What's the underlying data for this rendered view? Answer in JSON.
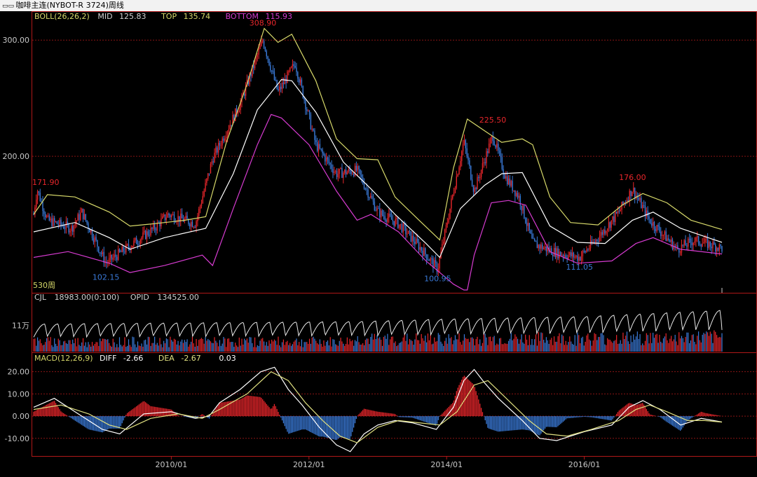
{
  "window": {
    "title": "咖啡主连(NYBOT-R 3724)周线",
    "icon": "chart-window-icon"
  },
  "colors": {
    "background": "#000000",
    "frame": "#b01818",
    "grid": "#8a1414",
    "up": "#e8262b",
    "down": "#3a7ad8",
    "mid": "#ffffff",
    "top": "#d7d96a",
    "bottom": "#d63bd0",
    "diff": "#ffffff",
    "dea": "#e0e080",
    "label": "#c8c8c8"
  },
  "chart_data": [
    {
      "panel": "price",
      "type": "candlestick",
      "indicator": {
        "name": "BOLL(26,26,2)",
        "mid_label": "MID",
        "mid": "125.83",
        "top_label": "TOP",
        "top": "135.74",
        "bottom_label": "BOTTOM",
        "bottom": "115.93"
      },
      "y_ticks": [
        "300.00",
        "200.00"
      ],
      "y_tick_values": [
        300,
        200
      ],
      "ylim": [
        85,
        320
      ],
      "bars_label": "530周",
      "annotations": [
        {
          "text": "171.90",
          "value": 171.9,
          "t": 0.0,
          "color": "up"
        },
        {
          "text": "102.15",
          "value": 102.15,
          "t": 0.105,
          "color": "down"
        },
        {
          "text": "308.90",
          "value": 308.9,
          "t": 0.333,
          "color": "up"
        },
        {
          "text": "100.95",
          "value": 100.95,
          "t": 0.587,
          "color": "down"
        },
        {
          "text": "225.50",
          "value": 225.5,
          "t": 0.667,
          "color": "up"
        },
        {
          "text": "111.05",
          "value": 111.05,
          "t": 0.793,
          "color": "down"
        },
        {
          "text": "176.00",
          "value": 176.0,
          "t": 0.87,
          "color": "up"
        }
      ],
      "trend": [
        {
          "t": 0.0,
          "v": 150
        },
        {
          "t": 0.005,
          "v": 171.9
        },
        {
          "t": 0.02,
          "v": 145
        },
        {
          "t": 0.055,
          "v": 138
        },
        {
          "t": 0.07,
          "v": 152
        },
        {
          "t": 0.105,
          "v": 108
        },
        {
          "t": 0.14,
          "v": 123
        },
        {
          "t": 0.175,
          "v": 138
        },
        {
          "t": 0.195,
          "v": 150
        },
        {
          "t": 0.235,
          "v": 142
        },
        {
          "t": 0.26,
          "v": 198
        },
        {
          "t": 0.3,
          "v": 245
        },
        {
          "t": 0.333,
          "v": 300
        },
        {
          "t": 0.355,
          "v": 255
        },
        {
          "t": 0.38,
          "v": 280
        },
        {
          "t": 0.41,
          "v": 210
        },
        {
          "t": 0.44,
          "v": 185
        },
        {
          "t": 0.47,
          "v": 188
        },
        {
          "t": 0.5,
          "v": 152
        },
        {
          "t": 0.53,
          "v": 142
        },
        {
          "t": 0.555,
          "v": 126
        },
        {
          "t": 0.587,
          "v": 103
        },
        {
          "t": 0.61,
          "v": 170
        },
        {
          "t": 0.625,
          "v": 213
        },
        {
          "t": 0.64,
          "v": 170
        },
        {
          "t": 0.667,
          "v": 218
        },
        {
          "t": 0.685,
          "v": 183
        },
        {
          "t": 0.705,
          "v": 165
        },
        {
          "t": 0.725,
          "v": 125
        },
        {
          "t": 0.76,
          "v": 117
        },
        {
          "t": 0.793,
          "v": 113
        },
        {
          "t": 0.82,
          "v": 130
        },
        {
          "t": 0.85,
          "v": 152
        },
        {
          "t": 0.87,
          "v": 172
        },
        {
          "t": 0.895,
          "v": 145
        },
        {
          "t": 0.935,
          "v": 120
        },
        {
          "t": 0.96,
          "v": 128
        },
        {
          "t": 1.0,
          "v": 121
        }
      ],
      "boll_top": [
        {
          "t": 0.0,
          "v": 150
        },
        {
          "t": 0.02,
          "v": 167
        },
        {
          "t": 0.06,
          "v": 165
        },
        {
          "t": 0.11,
          "v": 152
        },
        {
          "t": 0.14,
          "v": 140
        },
        {
          "t": 0.175,
          "v": 142
        },
        {
          "t": 0.22,
          "v": 145
        },
        {
          "t": 0.25,
          "v": 148
        },
        {
          "t": 0.28,
          "v": 212
        },
        {
          "t": 0.31,
          "v": 262
        },
        {
          "t": 0.335,
          "v": 310
        },
        {
          "t": 0.355,
          "v": 298
        },
        {
          "t": 0.375,
          "v": 305
        },
        {
          "t": 0.41,
          "v": 265
        },
        {
          "t": 0.44,
          "v": 215
        },
        {
          "t": 0.47,
          "v": 198
        },
        {
          "t": 0.5,
          "v": 197
        },
        {
          "t": 0.525,
          "v": 165
        },
        {
          "t": 0.56,
          "v": 145
        },
        {
          "t": 0.59,
          "v": 128
        },
        {
          "t": 0.61,
          "v": 190
        },
        {
          "t": 0.63,
          "v": 232
        },
        {
          "t": 0.655,
          "v": 222
        },
        {
          "t": 0.68,
          "v": 212
        },
        {
          "t": 0.71,
          "v": 215
        },
        {
          "t": 0.725,
          "v": 210
        },
        {
          "t": 0.75,
          "v": 165
        },
        {
          "t": 0.78,
          "v": 143
        },
        {
          "t": 0.82,
          "v": 141
        },
        {
          "t": 0.855,
          "v": 158
        },
        {
          "t": 0.885,
          "v": 168
        },
        {
          "t": 0.92,
          "v": 160
        },
        {
          "t": 0.955,
          "v": 145
        },
        {
          "t": 1.0,
          "v": 137
        }
      ],
      "boll_mid": [
        {
          "t": 0.0,
          "v": 135
        },
        {
          "t": 0.06,
          "v": 143
        },
        {
          "t": 0.11,
          "v": 130
        },
        {
          "t": 0.14,
          "v": 120
        },
        {
          "t": 0.19,
          "v": 130
        },
        {
          "t": 0.25,
          "v": 138
        },
        {
          "t": 0.29,
          "v": 185
        },
        {
          "t": 0.325,
          "v": 240
        },
        {
          "t": 0.36,
          "v": 266
        },
        {
          "t": 0.375,
          "v": 265
        },
        {
          "t": 0.41,
          "v": 238
        },
        {
          "t": 0.45,
          "v": 195
        },
        {
          "t": 0.49,
          "v": 172
        },
        {
          "t": 0.525,
          "v": 150
        },
        {
          "t": 0.57,
          "v": 125
        },
        {
          "t": 0.59,
          "v": 113
        },
        {
          "t": 0.62,
          "v": 155
        },
        {
          "t": 0.655,
          "v": 175
        },
        {
          "t": 0.68,
          "v": 185
        },
        {
          "t": 0.71,
          "v": 186
        },
        {
          "t": 0.75,
          "v": 140
        },
        {
          "t": 0.79,
          "v": 126
        },
        {
          "t": 0.83,
          "v": 125
        },
        {
          "t": 0.87,
          "v": 145
        },
        {
          "t": 0.9,
          "v": 152
        },
        {
          "t": 0.94,
          "v": 138
        },
        {
          "t": 1.0,
          "v": 126
        }
      ],
      "boll_bottom": [
        {
          "t": 0.0,
          "v": 113
        },
        {
          "t": 0.05,
          "v": 118
        },
        {
          "t": 0.11,
          "v": 108
        },
        {
          "t": 0.14,
          "v": 100
        },
        {
          "t": 0.19,
          "v": 106
        },
        {
          "t": 0.245,
          "v": 115
        },
        {
          "t": 0.26,
          "v": 106
        },
        {
          "t": 0.29,
          "v": 155
        },
        {
          "t": 0.325,
          "v": 210
        },
        {
          "t": 0.345,
          "v": 236
        },
        {
          "t": 0.36,
          "v": 233
        },
        {
          "t": 0.4,
          "v": 210
        },
        {
          "t": 0.44,
          "v": 170
        },
        {
          "t": 0.47,
          "v": 145
        },
        {
          "t": 0.49,
          "v": 150
        },
        {
          "t": 0.53,
          "v": 135
        },
        {
          "t": 0.57,
          "v": 110
        },
        {
          "t": 0.59,
          "v": 100
        },
        {
          "t": 0.61,
          "v": 90
        },
        {
          "t": 0.625,
          "v": 85
        },
        {
          "t": 0.63,
          "v": 85
        },
        {
          "t": 0.64,
          "v": 115
        },
        {
          "t": 0.665,
          "v": 160
        },
        {
          "t": 0.69,
          "v": 162
        },
        {
          "t": 0.715,
          "v": 158
        },
        {
          "t": 0.75,
          "v": 118
        },
        {
          "t": 0.79,
          "v": 108
        },
        {
          "t": 0.84,
          "v": 110
        },
        {
          "t": 0.875,
          "v": 125
        },
        {
          "t": 0.9,
          "v": 130
        },
        {
          "t": 0.94,
          "v": 120
        },
        {
          "t": 1.0,
          "v": 116
        }
      ]
    },
    {
      "panel": "volume",
      "type": "bar",
      "indicator": {
        "name": "CJL",
        "cjl": "18983.00(0:100)",
        "opid_label": "OPID",
        "opid": "134525.00"
      },
      "y_ticks": [
        "11万"
      ],
      "y_tick_values": [
        110000
      ],
      "ylim": [
        0,
        200000
      ],
      "volume_level": [
        {
          "t": 0.0,
          "v": 45000
        },
        {
          "t": 0.45,
          "v": 45000
        },
        {
          "t": 0.47,
          "v": 55000
        },
        {
          "t": 0.8,
          "v": 60000
        },
        {
          "t": 1.0,
          "v": 65000
        }
      ],
      "opid_level": [
        {
          "t": 0.0,
          "v": 110000
        },
        {
          "t": 0.47,
          "v": 120000
        },
        {
          "t": 0.6,
          "v": 130000
        },
        {
          "t": 0.8,
          "v": 140000
        },
        {
          "t": 1.0,
          "v": 165000
        }
      ]
    },
    {
      "panel": "macd",
      "type": "bar+line",
      "indicator": {
        "name": "MACD(12,26,9)",
        "diff_label": "DIFF",
        "diff": "-2.66",
        "dea_label": "DEA",
        "dea": "-2.67",
        "macd": "0.03"
      },
      "y_ticks": [
        "20.00",
        "10.00",
        "0.00",
        "-10.00"
      ],
      "y_tick_values": [
        20,
        10,
        0,
        -10
      ],
      "ylim": [
        -17,
        24
      ],
      "diff": [
        {
          "t": 0.0,
          "v": 4
        },
        {
          "t": 0.03,
          "v": 8
        },
        {
          "t": 0.07,
          "v": 0
        },
        {
          "t": 0.1,
          "v": -6
        },
        {
          "t": 0.125,
          "v": -8
        },
        {
          "t": 0.16,
          "v": 1
        },
        {
          "t": 0.2,
          "v": 2
        },
        {
          "t": 0.235,
          "v": -1
        },
        {
          "t": 0.255,
          "v": 0
        },
        {
          "t": 0.27,
          "v": 6
        },
        {
          "t": 0.3,
          "v": 12
        },
        {
          "t": 0.33,
          "v": 20
        },
        {
          "t": 0.35,
          "v": 22
        },
        {
          "t": 0.37,
          "v": 12
        },
        {
          "t": 0.39,
          "v": 5
        },
        {
          "t": 0.415,
          "v": -5
        },
        {
          "t": 0.44,
          "v": -13
        },
        {
          "t": 0.46,
          "v": -16
        },
        {
          "t": 0.48,
          "v": -8
        },
        {
          "t": 0.5,
          "v": -4
        },
        {
          "t": 0.525,
          "v": -2
        },
        {
          "t": 0.55,
          "v": -3
        },
        {
          "t": 0.585,
          "v": -6
        },
        {
          "t": 0.61,
          "v": 4
        },
        {
          "t": 0.625,
          "v": 16
        },
        {
          "t": 0.64,
          "v": 21
        },
        {
          "t": 0.655,
          "v": 15
        },
        {
          "t": 0.675,
          "v": 8
        },
        {
          "t": 0.71,
          "v": -2
        },
        {
          "t": 0.735,
          "v": -10
        },
        {
          "t": 0.76,
          "v": -11
        },
        {
          "t": 0.8,
          "v": -7
        },
        {
          "t": 0.84,
          "v": -4
        },
        {
          "t": 0.865,
          "v": 4
        },
        {
          "t": 0.885,
          "v": 7
        },
        {
          "t": 0.91,
          "v": 3
        },
        {
          "t": 0.94,
          "v": -4
        },
        {
          "t": 0.97,
          "v": -1
        },
        {
          "t": 1.0,
          "v": -2.66
        }
      ],
      "dea": [
        {
          "t": 0.0,
          "v": 3
        },
        {
          "t": 0.04,
          "v": 5
        },
        {
          "t": 0.08,
          "v": 1
        },
        {
          "t": 0.11,
          "v": -4
        },
        {
          "t": 0.135,
          "v": -6
        },
        {
          "t": 0.17,
          "v": -1
        },
        {
          "t": 0.21,
          "v": 1
        },
        {
          "t": 0.245,
          "v": -1
        },
        {
          "t": 0.27,
          "v": 3
        },
        {
          "t": 0.31,
          "v": 10
        },
        {
          "t": 0.345,
          "v": 20
        },
        {
          "t": 0.37,
          "v": 16
        },
        {
          "t": 0.395,
          "v": 6
        },
        {
          "t": 0.42,
          "v": -2
        },
        {
          "t": 0.445,
          "v": -9
        },
        {
          "t": 0.47,
          "v": -12
        },
        {
          "t": 0.5,
          "v": -5
        },
        {
          "t": 0.53,
          "v": -2
        },
        {
          "t": 0.56,
          "v": -3
        },
        {
          "t": 0.59,
          "v": -4
        },
        {
          "t": 0.615,
          "v": 2
        },
        {
          "t": 0.64,
          "v": 14
        },
        {
          "t": 0.66,
          "v": 16
        },
        {
          "t": 0.68,
          "v": 10
        },
        {
          "t": 0.72,
          "v": -2
        },
        {
          "t": 0.745,
          "v": -8
        },
        {
          "t": 0.775,
          "v": -9
        },
        {
          "t": 0.81,
          "v": -6
        },
        {
          "t": 0.85,
          "v": -2
        },
        {
          "t": 0.875,
          "v": 3
        },
        {
          "t": 0.895,
          "v": 5
        },
        {
          "t": 0.92,
          "v": 2
        },
        {
          "t": 0.95,
          "v": -2
        },
        {
          "t": 0.975,
          "v": -2
        },
        {
          "t": 1.0,
          "v": -2.67
        }
      ]
    }
  ],
  "x_axis": {
    "ticks": [
      {
        "label": "2010/01",
        "t": 0.2
      },
      {
        "label": "2012/01",
        "t": 0.4
      },
      {
        "label": "2014/01",
        "t": 0.6
      },
      {
        "label": "2016/01",
        "t": 0.8
      }
    ]
  }
}
